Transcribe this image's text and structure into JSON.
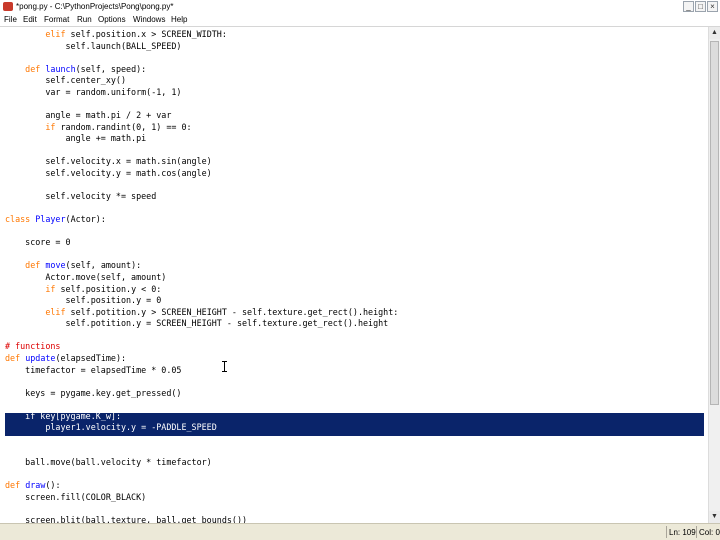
{
  "window": {
    "title": "*pong.py - C:\\PythonProjects\\Pong\\pong.py*",
    "controls": {
      "minimize": "_",
      "maximize": "□",
      "close": "×"
    }
  },
  "menu": [
    "File",
    "Edit",
    "Format",
    "Run",
    "Options",
    "Windows",
    "Help"
  ],
  "editor": {
    "selected_lines": [
      0,
      1
    ],
    "code_top": [
      [
        {
          "t": "        "
        },
        {
          "t": "elif",
          "c": "kw"
        },
        {
          "t": " self.position.x > SCREEN_WIDTH:"
        }
      ],
      [
        {
          "t": "            self.launch(BALL_SPEED)"
        }
      ],
      [
        {
          "t": ""
        }
      ],
      [
        {
          "t": "    "
        },
        {
          "t": "def",
          "c": "kw"
        },
        {
          "t": " "
        },
        {
          "t": "launch",
          "c": "fn"
        },
        {
          "t": "(self, speed):"
        }
      ],
      [
        {
          "t": "        self.center_xy()"
        }
      ],
      [
        {
          "t": "        var = random.uniform(-1, 1)"
        }
      ],
      [
        {
          "t": ""
        }
      ],
      [
        {
          "t": "        angle = math.pi / 2 + var"
        }
      ],
      [
        {
          "t": "        "
        },
        {
          "t": "if",
          "c": "kw"
        },
        {
          "t": " random.randint(0, 1) == 0:"
        }
      ],
      [
        {
          "t": "            angle += math.pi"
        }
      ],
      [
        {
          "t": ""
        }
      ],
      [
        {
          "t": "        self.velocity.x = math.sin(angle)"
        }
      ],
      [
        {
          "t": "        self.velocity.y = math.cos(angle)"
        }
      ],
      [
        {
          "t": ""
        }
      ],
      [
        {
          "t": "        self.velocity *= speed"
        }
      ],
      [
        {
          "t": ""
        }
      ],
      [
        {
          "t": "class",
          "c": "kw"
        },
        {
          "t": " "
        },
        {
          "t": "Player",
          "c": "fn"
        },
        {
          "t": "(Actor):"
        }
      ],
      [
        {
          "t": ""
        }
      ],
      [
        {
          "t": "    score = 0"
        }
      ],
      [
        {
          "t": ""
        }
      ],
      [
        {
          "t": "    "
        },
        {
          "t": "def",
          "c": "kw"
        },
        {
          "t": " "
        },
        {
          "t": "move",
          "c": "fn"
        },
        {
          "t": "(self, amount):"
        }
      ],
      [
        {
          "t": "        Actor.move(self, amount)"
        }
      ],
      [
        {
          "t": "        "
        },
        {
          "t": "if",
          "c": "kw"
        },
        {
          "t": " self.position.y < 0:"
        }
      ],
      [
        {
          "t": "            self.position.y = 0"
        }
      ],
      [
        {
          "t": "        "
        },
        {
          "t": "elif",
          "c": "kw"
        },
        {
          "t": " self.potition.y > SCREEN_HEIGHT - self.texture.get_rect().height:"
        }
      ],
      [
        {
          "t": "            self.potition.y = SCREEN_HEIGHT - self.texture.get_rect().height"
        }
      ],
      [
        {
          "t": ""
        }
      ],
      [
        {
          "t": "# functions",
          "c": "cm"
        }
      ],
      [
        {
          "t": "def",
          "c": "kw"
        },
        {
          "t": " "
        },
        {
          "t": "update",
          "c": "fn"
        },
        {
          "t": "(elapsedTime):"
        }
      ],
      [
        {
          "t": "    timefactor = elapsedTime * 0.05"
        }
      ],
      [
        {
          "t": ""
        }
      ],
      [
        {
          "t": "    keys = pygame.key.get_pressed()"
        }
      ],
      [
        {
          "t": ""
        }
      ]
    ],
    "code_selected": [
      [
        {
          "t": "    "
        },
        {
          "t": "if",
          "c": "kw"
        },
        {
          "t": " key[pygame.K_w]:"
        }
      ],
      [
        {
          "t": "        player1.velocity.y = -PADDLE_SPEED"
        }
      ]
    ],
    "code_bottom": [
      [
        {
          "t": ""
        }
      ],
      [
        {
          "t": ""
        }
      ],
      [
        {
          "t": "    ball.move(ball.velocity * timefactor)"
        }
      ],
      [
        {
          "t": ""
        }
      ],
      [
        {
          "t": "def",
          "c": "kw"
        },
        {
          "t": " "
        },
        {
          "t": "draw",
          "c": "fn"
        },
        {
          "t": "():"
        }
      ],
      [
        {
          "t": "    screen.fill(COLOR_BLACK)"
        }
      ],
      [
        {
          "t": ""
        }
      ],
      [
        {
          "t": "    screen.blit(ball.texture, ball.get_bounds())"
        }
      ]
    ]
  },
  "scrollbar": {
    "up_arrow": "▲",
    "down_arrow": "▼",
    "position": 0.52
  },
  "status": {
    "line": "Ln: 109",
    "col": "Col: 0"
  },
  "colors": {
    "keyword": "#ff7700",
    "definition": "#0000ff",
    "comment": "#dd0000",
    "selection": "#0a246a",
    "statusbar": "#ece9d8"
  }
}
